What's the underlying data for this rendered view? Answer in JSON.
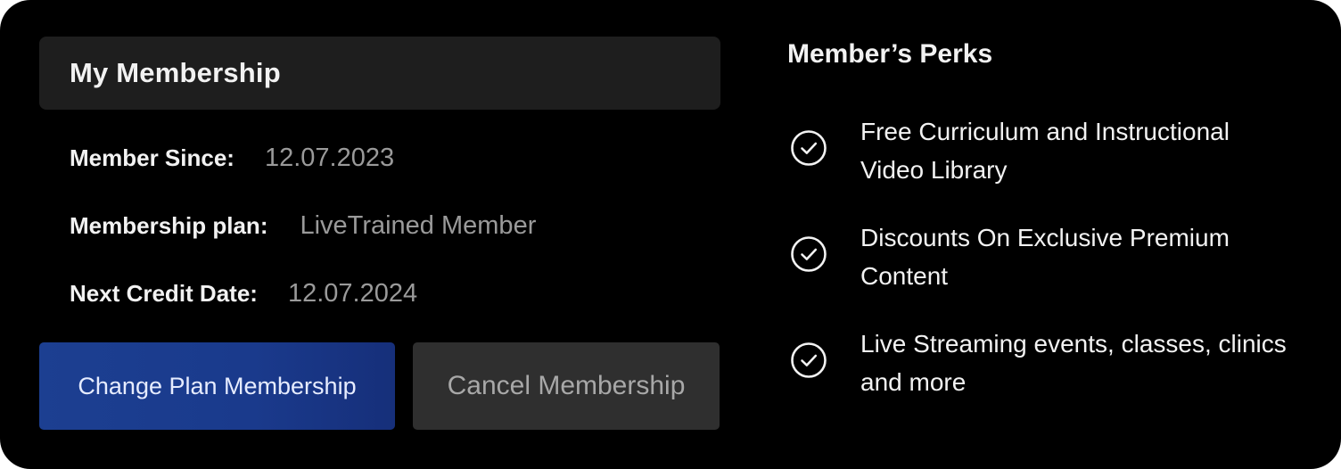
{
  "membership": {
    "title": "My Membership",
    "rows": [
      {
        "label": "Member Since:",
        "value": "12.07.2023"
      },
      {
        "label": "Membership plan:",
        "value": "LiveTrained Member"
      },
      {
        "label": "Next Credit Date:",
        "value": "12.07.2024"
      }
    ],
    "buttons": {
      "change_plan": "Change Plan Membership",
      "cancel": "Cancel Membership"
    }
  },
  "perks": {
    "title": "Member’s Perks",
    "icon": "check-circle-icon",
    "items": [
      {
        "text": "Free Curriculum and Instructional Video Library"
      },
      {
        "text": "Discounts On Exclusive Premium Content"
      },
      {
        "text": "Live Streaming events, classes, clinics and more"
      }
    ]
  },
  "colors": {
    "background": "#000000",
    "panel": "#1e1e1e",
    "primary_button": "#1a3a8c",
    "secondary_button": "#2f2f2f",
    "muted_text": "#9a9a9a"
  }
}
